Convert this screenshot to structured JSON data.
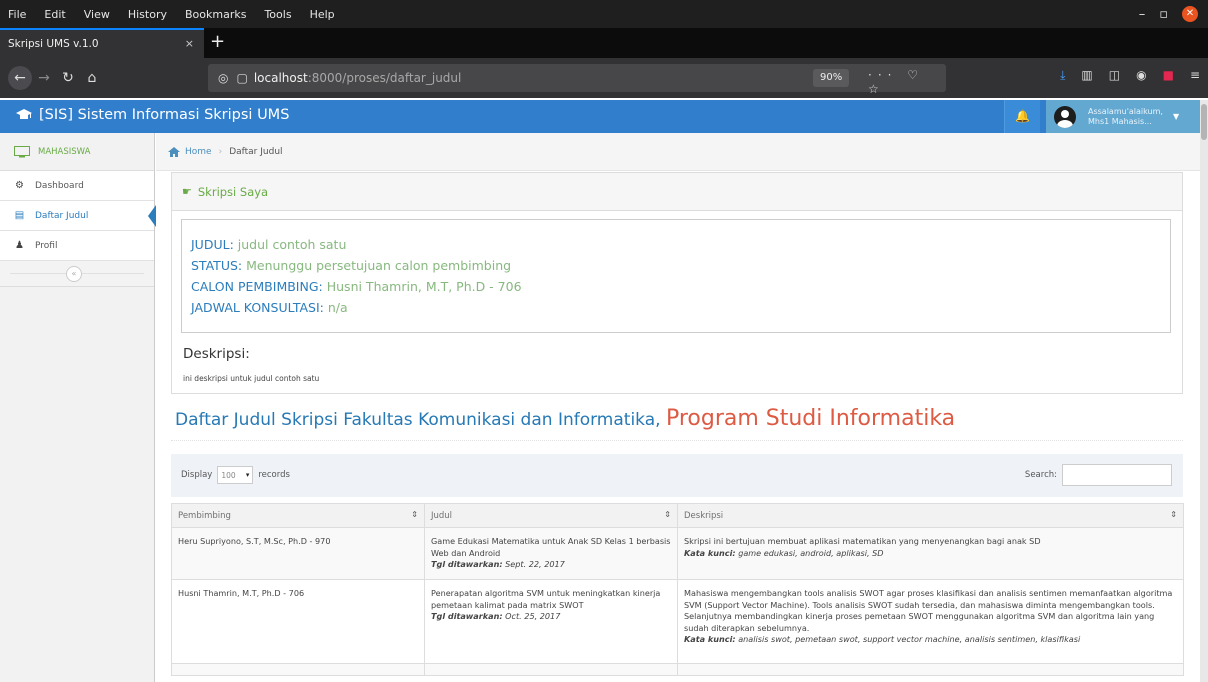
{
  "browser": {
    "menu": [
      "File",
      "Edit",
      "View",
      "History",
      "Bookmarks",
      "Tools",
      "Help"
    ],
    "tab_title": "Skripsi UMS v.1.0",
    "tab_close": "×",
    "new_tab": "+",
    "url_host": "localhost",
    "url_path": ":8000/proses/daftar_judul",
    "zoom": "90%"
  },
  "header": {
    "brand": "[SIS] Sistem Informasi Skripsi UMS",
    "greeting": "Assalamu'alaikum,",
    "user": "Mhs1 Mahasis..."
  },
  "sidebar": {
    "shortcut_label": "MAHASISWA",
    "items": [
      {
        "label": "Dashboard",
        "icon": "tachometer-icon"
      },
      {
        "label": "Daftar Judul",
        "icon": "list-icon"
      },
      {
        "label": "Profil",
        "icon": "user-icon"
      }
    ]
  },
  "breadcrumb": {
    "home": "Home",
    "current": "Daftar Judul"
  },
  "skripsi": {
    "title": "Skripsi Saya",
    "judul_label": "JUDUL:",
    "judul_value": "judul contoh satu",
    "status_label": "STATUS:",
    "status_value": "Menunggu persetujuan calon pembimbing",
    "calon_label": "CALON PEMBIMBING:",
    "calon_value": "Husni Thamrin, M.T, Ph.D - 706",
    "jadwal_label": "JADWAL KONSULTASI:",
    "jadwal_value": "n/a",
    "desc_title": "Deskripsi:",
    "desc_text": "ini deskripsi untuk judul contoh satu"
  },
  "list": {
    "title": "Daftar Judul Skripsi Fakultas Komunikasi dan Informatika,",
    "program": "Program Studi Informatika",
    "display_label": "Display",
    "display_value": "100",
    "records_label": "records",
    "search_label": "Search:",
    "columns": [
      "Pembimbing",
      "Judul",
      "Deskripsi"
    ],
    "rows": [
      {
        "pembimbing": "Heru Supriyono, S.T, M.Sc, Ph.D - 970",
        "judul": "Game Edukasi Matematika untuk Anak SD Kelas 1 berbasis Web dan Android",
        "tgl_label": "Tgl ditawarkan:",
        "tgl_value": "Sept. 22, 2017",
        "deskripsi": "Skripsi ini bertujuan membuat aplikasi matematikan yang menyenangkan bagi anak SD",
        "kw_label": "Kata kunci:",
        "kw_value": "game edukasi, android, aplikasi, SD"
      },
      {
        "pembimbing": "Husni Thamrin, M.T, Ph.D - 706",
        "judul": "Penerapatan algoritma SVM untuk meningkatkan kinerja pemetaan kalimat pada matrix SWOT",
        "tgl_label": "Tgl ditawarkan:",
        "tgl_value": "Oct. 25, 2017",
        "deskripsi": "Mahasiswa mengembangkan tools analisis SWOT agar proses klasifikasi dan analisis sentimen memanfaatkan algoritma SVM (Support Vector Machine). Tools analisis SWOT sudah tersedia, dan mahasiswa diminta mengembangkan tools. Selanjutnya membandingkan kinerja proses pemetaan SWOT menggunakan algoritma SVM dan algoritma lain yang sudah diterapkan sebelumnya.",
        "kw_label": "Kata kunci:",
        "kw_value": "analisis swot, pemetaan swot, support vector machine, analisis sentimen, klasifikasi"
      }
    ]
  },
  "colors": {
    "header_bg": "#307ecc",
    "link_blue": "#2b7dbc",
    "value_green": "#87b87f",
    "program_red": "#dd5a43"
  }
}
